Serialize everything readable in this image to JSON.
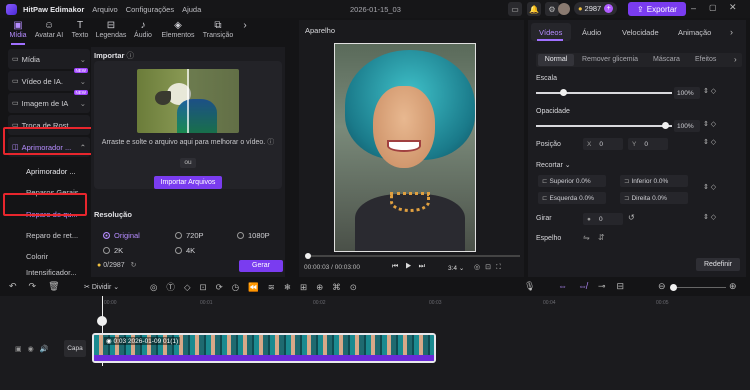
{
  "titlebar": {
    "app_name": "HitPaw Edimakor",
    "menu": [
      "Arquivo",
      "Configurações",
      "Ajuda"
    ],
    "project": "2026-01-15_03",
    "credits": "2987",
    "export_label": "Exportar"
  },
  "toolbar": {
    "tabs": [
      "Mídia",
      "Avatar AI",
      "Texto",
      "Legendas",
      "Áudio",
      "Elementos",
      "Transição"
    ],
    "icons": [
      "media-icon",
      "avatar-icon",
      "text-icon",
      "subtitles-icon",
      "audio-icon",
      "elements-icon",
      "transition-icon"
    ]
  },
  "sidebar": {
    "items": [
      {
        "label": "Mídia",
        "new": false
      },
      {
        "label": "Vídeo de IA.",
        "new": true
      },
      {
        "label": "Imagem de IA",
        "new": true
      },
      {
        "label": "Troca de Rost...",
        "new": false
      },
      {
        "label": "Aprimorador ...",
        "new": false
      }
    ],
    "sub": [
      "Aprimorador ...",
      "Reparos Gerais",
      "Reparo de qu...",
      "Reparo de ret...",
      "Colorir",
      "Intensificador..."
    ],
    "new_badge": "NEW"
  },
  "import_panel": {
    "title": "Importar",
    "drop_text": "Arraste e solte o arquivo aqui para melhorar o vídeo.",
    "or": "ou",
    "import_button": "Importar Arquivos",
    "resolution_title": "Resolução",
    "resolutions": [
      "Original",
      "720P",
      "1080P",
      "2K",
      "4K"
    ],
    "selected_resolution": "Original",
    "credits": "0/2987",
    "generate_button": "Gerar"
  },
  "preview": {
    "title": "Aparelho",
    "time": "00:00:03 / 00:03:00",
    "ratio": "3:4",
    "progress": 0.0
  },
  "properties": {
    "tabs": [
      "Vídeos",
      "Áudio",
      "Velocidade",
      "Animação"
    ],
    "subtabs": [
      "Normal",
      "Remover glicemia",
      "Máscara",
      "Efeitos"
    ],
    "scale_label": "Escala",
    "scale_value": "100%",
    "scale_level": 1.0,
    "opacity_label": "Opacidade",
    "opacity_value": "100%",
    "opacity_level": 1.0,
    "position_label": "Posição",
    "pos_x": "X",
    "pos_x_val": "0",
    "pos_y": "Y",
    "pos_y_val": "0",
    "crop_label": "Recortar",
    "crop": [
      {
        "label": "Superior",
        "value": "0.0%"
      },
      {
        "label": "Inferior",
        "value": "0.0%"
      },
      {
        "label": "Esquerda",
        "value": "0.0%"
      },
      {
        "label": "Direita",
        "value": "0.0%"
      }
    ],
    "rotate_label": "Girar",
    "rotate_value": "0",
    "mirror_label": "Espelho",
    "reset_label": "Redefinir"
  },
  "timeline": {
    "split_label": "Dividir",
    "ruler": [
      "00:00",
      "00:01",
      "00:02",
      "00:03",
      "00:04",
      "00:05",
      "00:06"
    ],
    "cover_label": "Capa",
    "clip_label": "0:03 2026-01-09 01(1)"
  }
}
